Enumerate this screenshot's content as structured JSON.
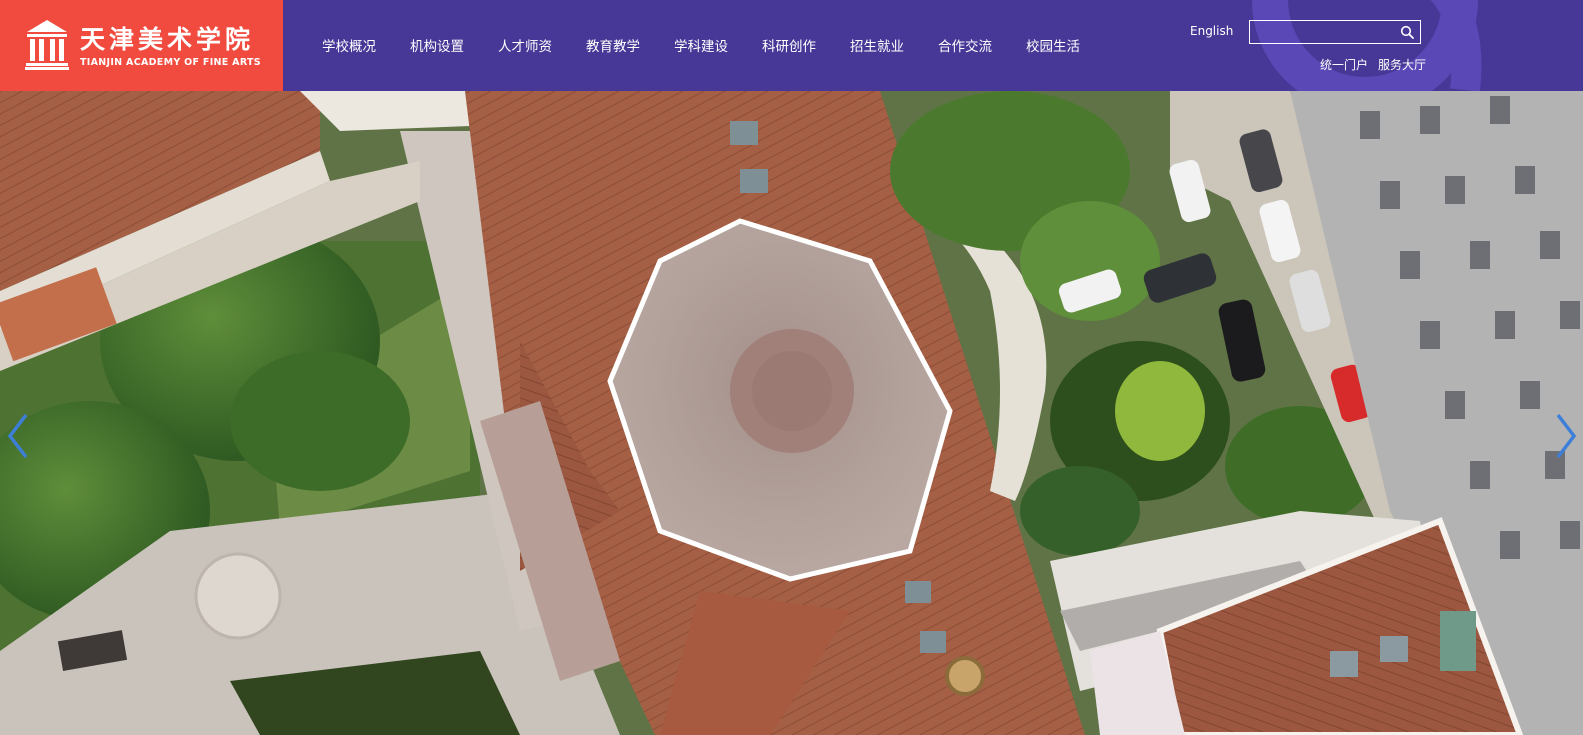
{
  "header": {
    "logo": {
      "name_cn": "天津美术学院",
      "name_en": "TIANJIN ACADEMY OF FINE ARTS"
    },
    "nav": [
      {
        "label": "学校概况"
      },
      {
        "label": "机构设置"
      },
      {
        "label": "人才师资"
      },
      {
        "label": "教育教学"
      },
      {
        "label": "学科建设"
      },
      {
        "label": "科研创作"
      },
      {
        "label": "招生就业"
      },
      {
        "label": "合作交流"
      },
      {
        "label": "校园生活"
      }
    ],
    "lang_link": "English",
    "search": {
      "value": "",
      "placeholder": ""
    },
    "sub_links": [
      {
        "label": "统一门户"
      },
      {
        "label": "服务大厅"
      }
    ]
  },
  "colors": {
    "nav_bg": "#473897",
    "logo_bg": "#f04b3e",
    "arrow": "#3d7fd8"
  },
  "icons": {
    "search": "search-icon",
    "prev": "chevron-left-icon",
    "next": "chevron-right-icon",
    "emblem": "columns-emblem-icon"
  }
}
